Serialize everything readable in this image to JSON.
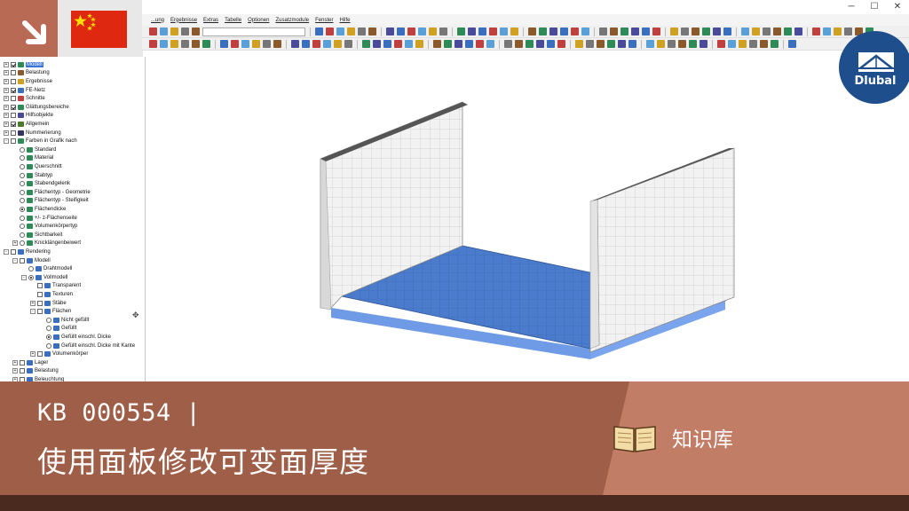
{
  "window": {
    "controls": [
      "─",
      "☐",
      "✕"
    ]
  },
  "menu": {
    "items": [
      "...ung",
      "Ergebnisse",
      "Extras",
      "Tabelle",
      "Optionen",
      "Zusatzmodule",
      "Fenster",
      "Hilfe"
    ]
  },
  "navigator": {
    "items": [
      {
        "label": "Modell",
        "indent": 0,
        "exp": "+",
        "ctrl": "chk-on",
        "icon": "#2e8b57",
        "selected": true
      },
      {
        "label": "Belastung",
        "indent": 0,
        "exp": "+",
        "ctrl": "chk",
        "icon": "#8a5a2a"
      },
      {
        "label": "Ergebnisse",
        "indent": 0,
        "exp": "+",
        "ctrl": "chk",
        "icon": "#d0a020"
      },
      {
        "label": "FE-Netz",
        "indent": 0,
        "exp": "+",
        "ctrl": "chk-on",
        "icon": "#3a6fc0"
      },
      {
        "label": "Schnitte",
        "indent": 0,
        "exp": "+",
        "ctrl": "chk",
        "icon": "#c04040"
      },
      {
        "label": "Glättungsbereiche",
        "indent": 0,
        "exp": "+",
        "ctrl": "chk-on",
        "icon": "#2e8b57"
      },
      {
        "label": "Hilfsobjekte",
        "indent": 0,
        "exp": "+",
        "ctrl": "chk",
        "icon": "#4a4a9a"
      },
      {
        "label": "Allgemein",
        "indent": 0,
        "exp": "+",
        "ctrl": "chk-on",
        "icon": "#4a7a2a"
      },
      {
        "label": "Nummerierung",
        "indent": 0,
        "exp": "+",
        "ctrl": "chk",
        "icon": "#333366"
      },
      {
        "label": "Farben in Grafik nach",
        "indent": 0,
        "exp": "-",
        "ctrl": "chk",
        "icon": "#2e8b57"
      },
      {
        "label": "Standard",
        "indent": 1,
        "exp": "",
        "ctrl": "rad",
        "icon": "#2e8b57"
      },
      {
        "label": "Material",
        "indent": 1,
        "exp": "",
        "ctrl": "rad",
        "icon": "#2e8b57"
      },
      {
        "label": "Querschnitt",
        "indent": 1,
        "exp": "",
        "ctrl": "rad",
        "icon": "#2e8b57"
      },
      {
        "label": "Stabtyp",
        "indent": 1,
        "exp": "",
        "ctrl": "rad",
        "icon": "#2e8b57"
      },
      {
        "label": "Stabendgelenk",
        "indent": 1,
        "exp": "",
        "ctrl": "rad",
        "icon": "#2e8b57"
      },
      {
        "label": "Flächentyp - Geometrie",
        "indent": 1,
        "exp": "",
        "ctrl": "rad",
        "icon": "#2e8b57"
      },
      {
        "label": "Flächentyp - Steifigkeit",
        "indent": 1,
        "exp": "",
        "ctrl": "rad",
        "icon": "#2e8b57"
      },
      {
        "label": "Flächendicke",
        "indent": 1,
        "exp": "",
        "ctrl": "rad-on",
        "icon": "#2e8b57"
      },
      {
        "label": "+/- z-Flächenseite",
        "indent": 1,
        "exp": "",
        "ctrl": "rad",
        "icon": "#2e8b57"
      },
      {
        "label": "Volumenkörpertyp",
        "indent": 1,
        "exp": "",
        "ctrl": "rad",
        "icon": "#2e8b57"
      },
      {
        "label": "Sichtbarkeit",
        "indent": 1,
        "exp": "",
        "ctrl": "rad",
        "icon": "#2e8b57"
      },
      {
        "label": "Knicklängenbeiwert",
        "indent": 1,
        "exp": "+",
        "ctrl": "rad",
        "icon": "#2e8b57"
      },
      {
        "label": "Rendering",
        "indent": 0,
        "exp": "-",
        "ctrl": "chk",
        "icon": "#3a6fc0"
      },
      {
        "label": "Modell",
        "indent": 1,
        "exp": "-",
        "ctrl": "chk",
        "icon": "#3a6fc0"
      },
      {
        "label": "Drahtmodell",
        "indent": 2,
        "exp": "",
        "ctrl": "rad",
        "icon": "#3a6fc0"
      },
      {
        "label": "Vollmodell",
        "indent": 2,
        "exp": "-",
        "ctrl": "rad-on",
        "icon": "#3a6fc0"
      },
      {
        "label": "Transparent",
        "indent": 3,
        "exp": "",
        "ctrl": "chk",
        "icon": "#3a6fc0"
      },
      {
        "label": "Texturen",
        "indent": 3,
        "exp": "",
        "ctrl": "chk",
        "icon": "#3a6fc0"
      },
      {
        "label": "Stäbe",
        "indent": 3,
        "exp": "+",
        "ctrl": "chk",
        "icon": "#3a6fc0"
      },
      {
        "label": "Flächen",
        "indent": 3,
        "exp": "-",
        "ctrl": "chk",
        "icon": "#3a6fc0"
      },
      {
        "label": "Nicht gefüllt",
        "indent": 4,
        "exp": "",
        "ctrl": "rad",
        "icon": "#3a6fc0"
      },
      {
        "label": "Gefüllt",
        "indent": 4,
        "exp": "",
        "ctrl": "rad",
        "icon": "#3a6fc0"
      },
      {
        "label": "Gefüllt einschl. Dicke",
        "indent": 4,
        "exp": "",
        "ctrl": "rad-on",
        "icon": "#3a6fc0"
      },
      {
        "label": "Gefüllt einschl. Dicke mit Kante",
        "indent": 4,
        "exp": "",
        "ctrl": "rad",
        "icon": "#3a6fc0"
      },
      {
        "label": "Volumenkörper",
        "indent": 3,
        "exp": "+",
        "ctrl": "chk",
        "icon": "#3a6fc0"
      },
      {
        "label": "Lager",
        "indent": 1,
        "exp": "+",
        "ctrl": "chk",
        "icon": "#3a6fc0"
      },
      {
        "label": "Belastung",
        "indent": 1,
        "exp": "+",
        "ctrl": "chk",
        "icon": "#3a6fc0"
      },
      {
        "label": "Beleuchtung",
        "indent": 1,
        "exp": "+",
        "ctrl": "chk",
        "icon": "#3a6fc0"
      }
    ]
  },
  "banner": {
    "kb_line": "KB 000554 |",
    "title": "使用面板修改可变面厚度",
    "knowledge_label": "知识库"
  },
  "logo": {
    "text": "Dlubal"
  },
  "colors": {
    "banner": "#9e5e48",
    "banner_right": "#c17d66",
    "logo": "#1f4e8c",
    "slab": "#4d7ed0",
    "wall": "#f0f0f0"
  }
}
